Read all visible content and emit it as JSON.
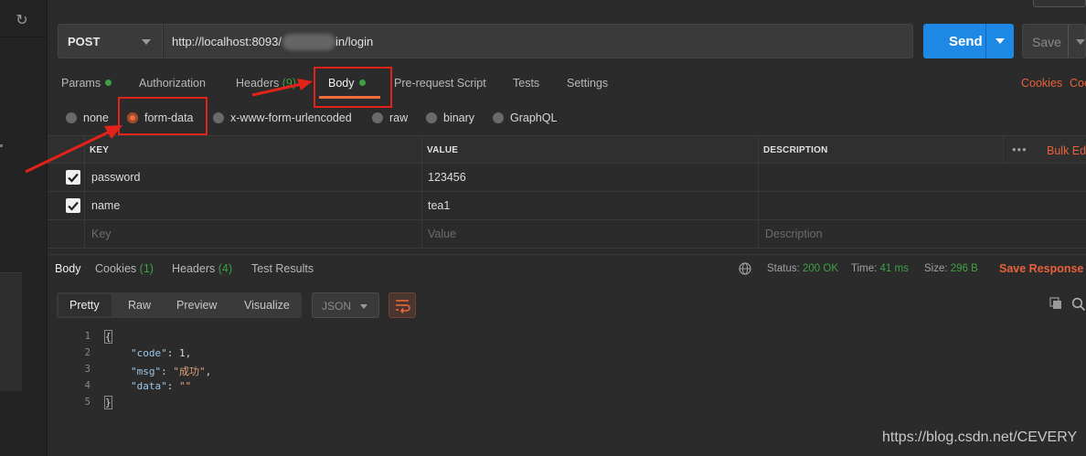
{
  "request": {
    "method": "POST",
    "url_prefix": "http://localhost:8093/",
    "url_suffix": "in/login",
    "send_label": "Send",
    "save_label": "Save"
  },
  "request_tabs": [
    {
      "label": "Params",
      "dot": true
    },
    {
      "label": "Authorization"
    },
    {
      "label": "Headers",
      "count": "(9)"
    },
    {
      "label": "Body",
      "dot": true,
      "active": true
    },
    {
      "label": "Pre-request Script"
    },
    {
      "label": "Tests"
    },
    {
      "label": "Settings"
    }
  ],
  "right_links": {
    "cookies": "Cookies",
    "code": "Coc"
  },
  "body_modes": [
    {
      "label": "none",
      "selected": false
    },
    {
      "label": "form-data",
      "selected": true
    },
    {
      "label": "x-www-form-urlencoded",
      "selected": false
    },
    {
      "label": "raw",
      "selected": false
    },
    {
      "label": "binary",
      "selected": false
    },
    {
      "label": "GraphQL",
      "selected": false
    }
  ],
  "table": {
    "headers": {
      "key": "KEY",
      "value": "VALUE",
      "description": "DESCRIPTION"
    },
    "more": "•••",
    "bulk_edit": "Bulk Ed",
    "rows": [
      {
        "checked": true,
        "key": "password",
        "value": "123456",
        "description": ""
      },
      {
        "checked": true,
        "key": "name",
        "value": "tea1",
        "description": ""
      }
    ],
    "placeholders": {
      "key": "Key",
      "value": "Value",
      "description": "Description"
    }
  },
  "response_tabs": [
    {
      "label": "Body",
      "active": true
    },
    {
      "label": "Cookies",
      "count": "(1)"
    },
    {
      "label": "Headers",
      "count": "(4)"
    },
    {
      "label": "Test Results"
    }
  ],
  "response_status": {
    "status_label": "Status:",
    "status_value": "200 OK",
    "time_label": "Time:",
    "time_value": "41 ms",
    "size_label": "Size:",
    "size_value": "296 B",
    "save_response": "Save Response"
  },
  "view_modes": [
    "Pretty",
    "Raw",
    "Preview",
    "Visualize"
  ],
  "language": "JSON",
  "code_lines": {
    "line_numbers": [
      "1",
      "2",
      "3",
      "4",
      "5"
    ],
    "open": "{",
    "code_key": "\"code\"",
    "code_val": "1",
    "msg_key": "\"msg\"",
    "msg_val": "\"成功\"",
    "data_key": "\"data\"",
    "data_val": "\"\"",
    "close": "}"
  },
  "watermark": "https://blog.csdn.net/CEVERY",
  "colors": {
    "accent": "#f26b3a",
    "send": "#1e88e5",
    "success": "#3fa142",
    "annotation": "#e2231a"
  }
}
